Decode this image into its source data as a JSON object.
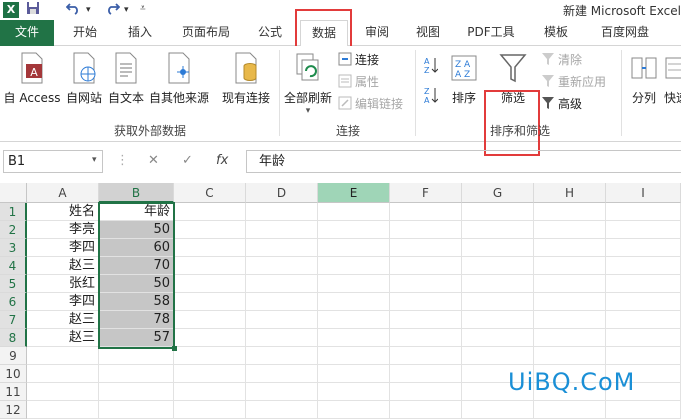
{
  "title_bar": {
    "app_icon": "X",
    "title": "新建 Microsoft Excel",
    "quick_access": [
      "save-icon",
      "undo-icon",
      "redo-icon"
    ]
  },
  "tabs": [
    {
      "label": "文件"
    },
    {
      "label": "开始"
    },
    {
      "label": "插入"
    },
    {
      "label": "页面布局"
    },
    {
      "label": "公式"
    },
    {
      "label": "数据"
    },
    {
      "label": "审阅"
    },
    {
      "label": "视图"
    },
    {
      "label": "PDF工具"
    },
    {
      "label": "模板"
    },
    {
      "label": "百度网盘"
    }
  ],
  "active_tab": "数据",
  "ribbon": {
    "get_external": {
      "group_label": "获取外部数据",
      "access": "自 Access",
      "web": "自网站",
      "text": "自文本",
      "other": "自其他来源",
      "existing": "现有连接"
    },
    "connections": {
      "group_label": "连接",
      "refresh_all": "全部刷新",
      "connections": "连接",
      "properties": "属性",
      "edit_links": "编辑链接"
    },
    "sort_filter": {
      "group_label": "排序和筛选",
      "sort": "排序",
      "filter": "筛选",
      "clear": "清除",
      "reapply": "重新应用",
      "advanced": "高级"
    },
    "data_tools": {
      "split": "分列",
      "quick": "快速"
    }
  },
  "formula_bar": {
    "name_box": "B1",
    "fx_label": "fx",
    "content": "年龄"
  },
  "columns": [
    "A",
    "B",
    "C",
    "D",
    "E",
    "F",
    "G",
    "H",
    "I"
  ],
  "rows": [
    "1",
    "2",
    "3",
    "4",
    "5",
    "6",
    "7",
    "8",
    "9",
    "10",
    "11",
    "12"
  ],
  "cells": [
    {
      "a": "姓名",
      "b": "年龄"
    },
    {
      "a": "李亮",
      "b": "50"
    },
    {
      "a": "李四",
      "b": "60"
    },
    {
      "a": "赵三",
      "b": "70"
    },
    {
      "a": "张红",
      "b": "50"
    },
    {
      "a": "李四",
      "b": "58"
    },
    {
      "a": "赵三",
      "b": "78"
    },
    {
      "a": "赵三",
      "b": "57"
    }
  ],
  "watermark": "UiBQ.CoM",
  "colors": {
    "excel_green": "#217346",
    "highlight_red": "#e23b3b",
    "selection_fill": "#c6c6c6",
    "watermark_blue": "#1a8fd6"
  }
}
